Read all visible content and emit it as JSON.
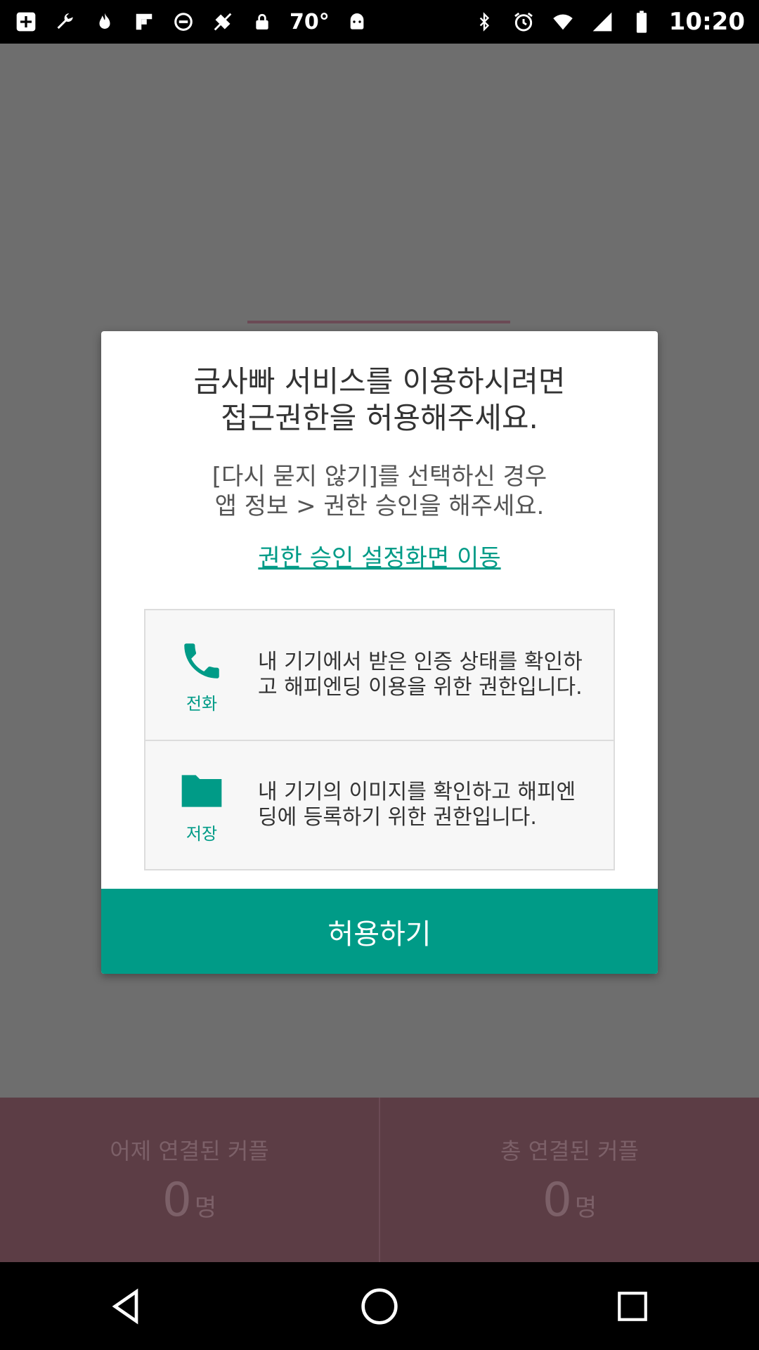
{
  "status_bar": {
    "icons": [
      "add-box-icon",
      "wrench-icon",
      "flame-icon",
      "flipboard-icon",
      "blocked-icon",
      "fake-gps-icon",
      "lock-icon"
    ],
    "temperature": "70°",
    "right_icons": [
      "bluetooth-icon",
      "alarm-icon",
      "wifi-icon",
      "signal-icon",
      "battery-icon"
    ],
    "time": "10:20"
  },
  "dialog": {
    "title": "금사빠 서비스를 이용하시려면\n접근권한을 허용해주세요.",
    "note": "[다시 묻지 않기]를 선택하신 경우\n앱 정보 > 권한 승인을 해주세요.",
    "settings_link": "권한 승인 설정화면 이동",
    "permissions": [
      {
        "icon": "phone-icon",
        "label": "전화",
        "description": "내 기기에서 받은 인증 상태를 확인하고 해피엔딩 이용을 위한 권한입니다."
      },
      {
        "icon": "folder-icon",
        "label": "저장",
        "description": "내 기기의 이미지를 확인하고 해피엔딩에 등록하기 위한 권한입니다."
      }
    ],
    "allow_button": "허용하기",
    "accent_color": "#009b87"
  },
  "background": {
    "stats": [
      {
        "label": "어제 연결된 커플",
        "value": "0",
        "unit": "명"
      },
      {
        "label": "총 연결된 커플",
        "value": "0",
        "unit": "명"
      }
    ]
  },
  "nav_bar": {
    "buttons": [
      "back-icon",
      "home-icon",
      "recents-icon"
    ]
  }
}
